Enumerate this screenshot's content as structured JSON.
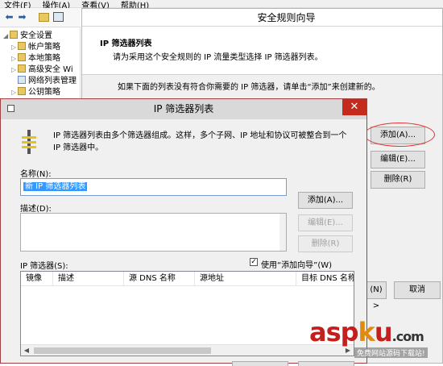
{
  "menubar": {
    "items": [
      "文件(F)",
      "操作(A)",
      "查看(V)",
      "帮助(H)"
    ]
  },
  "toolbar": {
    "icons": [
      "back-arrow-icon",
      "forward-arrow-icon",
      "folder-icon",
      "console-icon"
    ]
  },
  "tree": {
    "items": [
      {
        "label": "安全设置",
        "level": 0
      },
      {
        "label": "帐户策略",
        "level": 1
      },
      {
        "label": "本地策略",
        "level": 1
      },
      {
        "label": "高级安全 Wi",
        "level": 1
      },
      {
        "label": "网络列表管理",
        "level": 1
      },
      {
        "label": "公钥策略",
        "level": 1
      }
    ]
  },
  "wizard": {
    "title": "安全规则向导",
    "heading": "IP 筛选器列表",
    "subheading": "请为采用这个安全规则的 IP 流量类型选择 IP 筛选器列表。",
    "instruction": "如果下面的列表没有符合你需要的 IP 筛选器，请单击“添加”来创建新的。",
    "add_button": "添加(A)...",
    "edit_button": "编辑(E)...",
    "delete_button": "删除(R)",
    "next_button": "(N) >",
    "cancel_button": "取消"
  },
  "dialog": {
    "title": "IP 筛选器列表",
    "close_glyph": "✕",
    "description": "IP 筛选器列表由多个筛选器组成。这样，多个子网、IP 地址和协议可被整合到一个 IP 筛选器中。",
    "name_label": "名称(N):",
    "name_value": "新 IP 筛选器列表",
    "desc_label": "描述(D):",
    "add_button": "添加(A)...",
    "edit_button": "编辑(E)...",
    "delete_button": "删除(R)",
    "filters_label": "IP 筛选器(S):",
    "use_wizard_label": "使用“添加向导”(W)",
    "use_wizard_checked": true,
    "columns": [
      "镜像",
      "描述",
      "源 DNS 名称",
      "源地址",
      "目标 DNS 名称"
    ]
  },
  "watermark": {
    "main_a": "asp",
    "main_k": "k",
    "main_b": "u",
    "domain": ".com",
    "sub": "免费网站源码下载站!"
  },
  "colors": {
    "close_red": "#c42b1c",
    "selection_blue": "#3399ff",
    "circle_red": "#dd3333",
    "watermark_red": "#c41e1e"
  }
}
